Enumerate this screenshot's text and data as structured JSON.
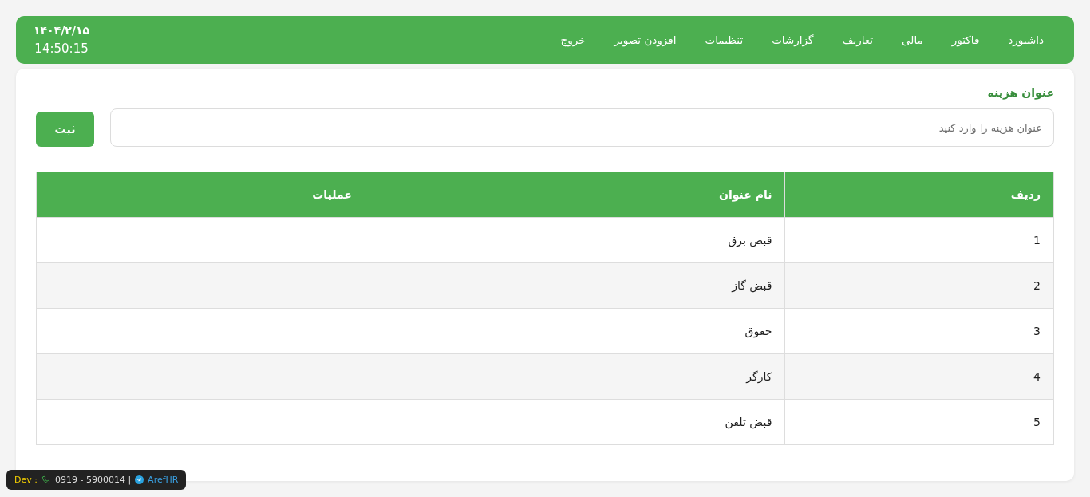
{
  "header": {
    "nav_items": [
      "داشبورد",
      "فاکتور",
      "مالی",
      "تعاریف",
      "گزارشات",
      "تنظیمات",
      "افزودن تصویر",
      "خروج"
    ],
    "date": "۱۴۰۴/۲/۱۵",
    "time": "14:50:15"
  },
  "form": {
    "label": "عنوان هزینه",
    "input": {
      "placeholder": "عنوان هزینه را وارد کنید"
    },
    "submit_button": "ثبت"
  },
  "table": {
    "columns": [
      "ردیف",
      "نام عنوان",
      "عملیات"
    ],
    "rows": [
      {
        "row_number": "1",
        "title": "قبض برق"
      },
      {
        "row_number": "2",
        "title": "قبض گاز"
      },
      {
        "row_number": "3",
        "title": "حقوق"
      },
      {
        "row_number": "4",
        "title": "کارگر"
      },
      {
        "row_number": "5",
        "title": "قبض تلفن"
      }
    ]
  },
  "developer_badge": {
    "label": "Dev :",
    "phone": "0919 - 5900014 |",
    "handle": "ArefHR"
  }
}
